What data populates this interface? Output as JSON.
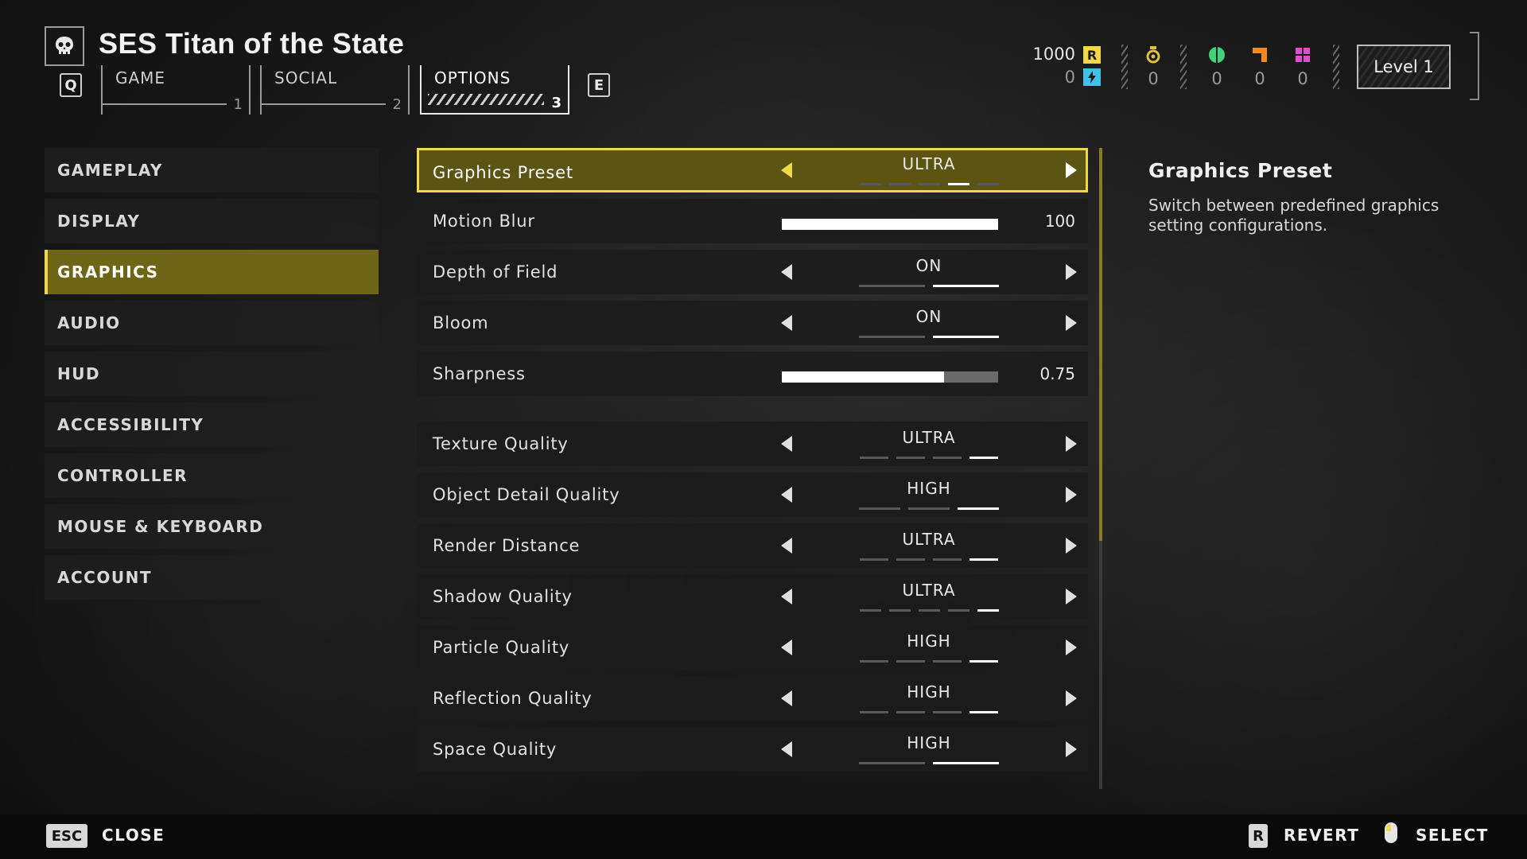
{
  "header": {
    "title": "SES Titan of the State",
    "key_left": "Q",
    "key_right": "E",
    "tabs": [
      {
        "label": "GAME",
        "num": "1"
      },
      {
        "label": "SOCIAL",
        "num": "2"
      },
      {
        "label": "OPTIONS",
        "num": "3"
      }
    ],
    "active_tab": "OPTIONS"
  },
  "currency": {
    "req_value": "1000",
    "req_badge": "R",
    "super_value": "0",
    "resources": [
      {
        "icon": "medal-icon",
        "value": "0",
        "color": "#e0c040"
      },
      {
        "icon": "common-sample-icon",
        "value": "0",
        "color": "#3fd37a"
      },
      {
        "icon": "rare-sample-icon",
        "value": "0",
        "color": "#f08a24"
      },
      {
        "icon": "super-sample-icon",
        "value": "0",
        "color": "#e04fd0"
      }
    ],
    "level": "Level 1"
  },
  "menu": {
    "items": [
      "GAMEPLAY",
      "DISPLAY",
      "GRAPHICS",
      "AUDIO",
      "HUD",
      "ACCESSIBILITY",
      "CONTROLLER",
      "MOUSE & KEYBOARD",
      "ACCOUNT"
    ],
    "active": "GRAPHICS"
  },
  "settings": [
    {
      "label": "Graphics Preset",
      "type": "option",
      "value": "ULTRA",
      "pips": 5,
      "selected_index": 3,
      "selected": true
    },
    {
      "label": "Motion Blur",
      "type": "slider",
      "value": "100",
      "fraction": 1.0
    },
    {
      "label": "Depth of Field",
      "type": "option",
      "value": "ON",
      "pips": 2,
      "selected_index": 1
    },
    {
      "label": "Bloom",
      "type": "option",
      "value": "ON",
      "pips": 2,
      "selected_index": 1
    },
    {
      "label": "Sharpness",
      "type": "slider",
      "value": "0.75",
      "fraction": 0.75
    },
    {
      "label": "Texture Quality",
      "type": "option",
      "value": "ULTRA",
      "pips": 4,
      "selected_index": 3
    },
    {
      "label": "Object Detail Quality",
      "type": "option",
      "value": "HIGH",
      "pips": 3,
      "selected_index": 2
    },
    {
      "label": "Render Distance",
      "type": "option",
      "value": "ULTRA",
      "pips": 4,
      "selected_index": 3
    },
    {
      "label": "Shadow Quality",
      "type": "option",
      "value": "ULTRA",
      "pips": 5,
      "selected_index": 4
    },
    {
      "label": "Particle Quality",
      "type": "option",
      "value": "HIGH",
      "pips": 4,
      "selected_index": 3
    },
    {
      "label": "Reflection Quality",
      "type": "option",
      "value": "HIGH",
      "pips": 4,
      "selected_index": 3
    },
    {
      "label": "Space Quality",
      "type": "option",
      "value": "HIGH",
      "pips": 2,
      "selected_index": 1
    }
  ],
  "description": {
    "title": "Graphics Preset",
    "text": "Switch between predefined graphics setting configurations."
  },
  "footer": {
    "close_key": "ESC",
    "close_label": "CLOSE",
    "revert_key": "R",
    "revert_label": "REVERT",
    "select_label": "SELECT"
  },
  "colors": {
    "accent": "#f1d84a",
    "selected_bg": "#5b5413",
    "menu_active_bg": "#6e6516"
  }
}
